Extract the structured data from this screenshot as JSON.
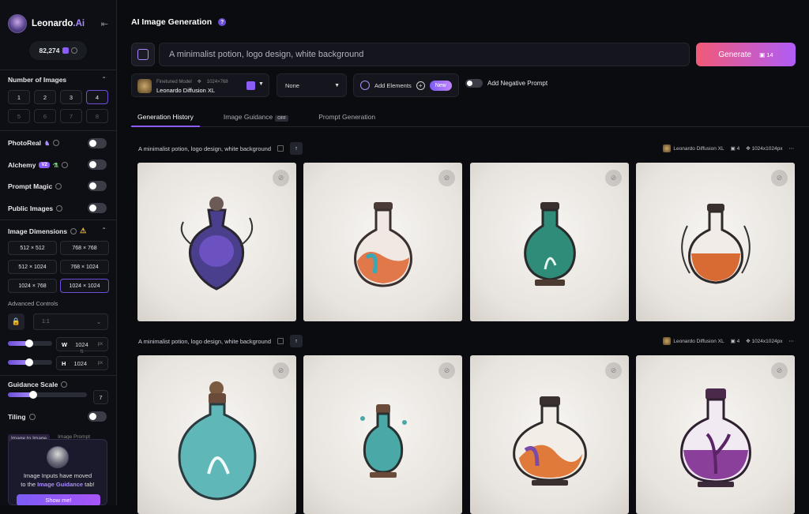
{
  "brand": {
    "name": "Leonardo",
    "suffix": ".Ai",
    "tokens": "82,274"
  },
  "sidebar": {
    "num_images_label": "Number of Images",
    "num_options": [
      "1",
      "2",
      "3",
      "4",
      "5",
      "6",
      "7",
      "8"
    ],
    "num_selected": "4",
    "photoreal": "PhotoReal",
    "alchemy": "Alchemy",
    "alchemy_badge": "V2",
    "prompt_magic": "Prompt Magic",
    "public_images": "Public Images",
    "image_dimensions": "Image Dimensions",
    "dimensions": [
      "512 × 512",
      "768 × 768",
      "512 × 1024",
      "768 × 1024",
      "1024 × 768",
      "1024 × 1024"
    ],
    "dimension_selected": "1024 × 1024",
    "advanced_controls": "Advanced Controls",
    "ratio": "1:1",
    "width_label": "W",
    "width_value": "1024",
    "height_label": "H",
    "height_value": "1024",
    "px": "px",
    "guidance_scale": "Guidance Scale",
    "guidance_value": "7",
    "tiling": "Tiling",
    "subtab_a": "Image to Image",
    "subtab_b": "Image Prompt",
    "callout_line1": "Image Inputs have moved",
    "callout_line2a": "to the ",
    "callout_line2b": "Image Guidance",
    "callout_line2c": " tab!",
    "show_me": "Show me!"
  },
  "header": {
    "title": "AI Image Generation",
    "help": "?"
  },
  "prompt": {
    "value": "A minimalist potion, logo design, white background"
  },
  "generate": {
    "label": "Generate",
    "count": "14"
  },
  "model": {
    "caption": "Finetuned Model",
    "size": "1024×768",
    "name": "Leonardo Diffusion XL"
  },
  "style": {
    "value": "None"
  },
  "elements": {
    "label": "Add Elements",
    "badge": "New"
  },
  "negative": {
    "label": "Add Negative Prompt"
  },
  "tabs": {
    "history": "Generation History",
    "guidance": "Image Guidance",
    "guidance_badge": "OFF",
    "prompt_gen": "Prompt Generation"
  },
  "generations": [
    {
      "prompt": "A minimalist potion, logo design, white background",
      "model": "Leonardo Diffusion XL",
      "count": "4",
      "size": "1024x1024px"
    },
    {
      "prompt": "A minimalist potion, logo design, white background",
      "model": "Leonardo Diffusion XL",
      "count": "4",
      "size": "1024x1024px"
    }
  ],
  "colors": {
    "accent": "#8b5cf6",
    "generate_from": "#f25a77",
    "generate_to": "#b05cf6"
  }
}
